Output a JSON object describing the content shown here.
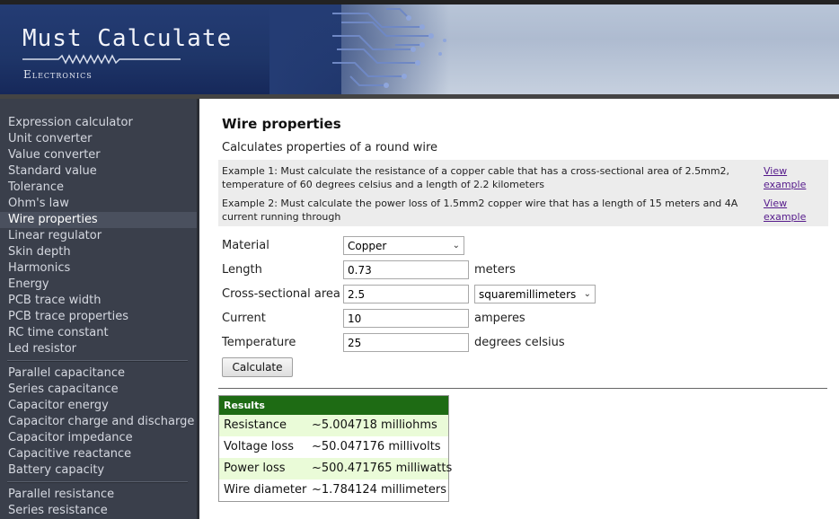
{
  "header": {
    "title": "Must Calculate",
    "subtitle": "Electronics"
  },
  "sidebar": {
    "groups": [
      [
        "Expression calculator",
        "Unit converter",
        "Value converter",
        "Standard value",
        "Tolerance",
        "Ohm's law",
        "Wire properties",
        "Linear regulator",
        "Skin depth",
        "Harmonics",
        "Energy",
        "PCB trace width",
        "PCB trace properties",
        "RC time constant",
        "Led resistor"
      ],
      [
        "Parallel capacitance",
        "Series capacitance",
        "Capacitor energy",
        "Capacitor charge and discharge",
        "Capacitor impedance",
        "Capacitive reactance",
        "Battery capacity"
      ],
      [
        "Parallel resistance",
        "Series resistance"
      ]
    ],
    "active": "Wire properties"
  },
  "main": {
    "title": "Wire properties",
    "description": "Calculates properties of a round wire",
    "examples": [
      {
        "text": "Example 1: Must calculate the resistance of a copper cable that has a cross-sectional area of 2.5mm2, temperature of 60 degrees celsius and a length of 2.2 kilometers",
        "link": "View example"
      },
      {
        "text": "Example 2: Must calculate the power loss of 1.5mm2 copper wire that has a length of 15 meters and 4A current running through",
        "link": "View example"
      }
    ],
    "form": {
      "material_label": "Material",
      "material_value": "Copper",
      "length_label": "Length",
      "length_value": "0.73",
      "length_unit": "meters",
      "area_label": "Cross-sectional area",
      "area_value": "2.5",
      "area_unit": "squaremillimeters",
      "current_label": "Current",
      "current_value": "10",
      "current_unit": "amperes",
      "temp_label": "Temperature",
      "temp_value": "25",
      "temp_unit": "degrees celsius",
      "calculate_label": "Calculate"
    },
    "results": {
      "heading": "Results",
      "rows": [
        {
          "label": "Resistance",
          "value": "~5.004718 milliohms"
        },
        {
          "label": "Voltage loss",
          "value": "~50.047176 millivolts"
        },
        {
          "label": "Power loss",
          "value": "~500.471765 milliwatts"
        },
        {
          "label": "Wire diameter",
          "value": "~1.784124 millimeters"
        }
      ]
    }
  },
  "colors": {
    "header_blue": "#243c74",
    "sidebar_bg": "#3a3f4b",
    "results_header": "#1e6b14",
    "results_alt_row": "#eafbd8"
  }
}
